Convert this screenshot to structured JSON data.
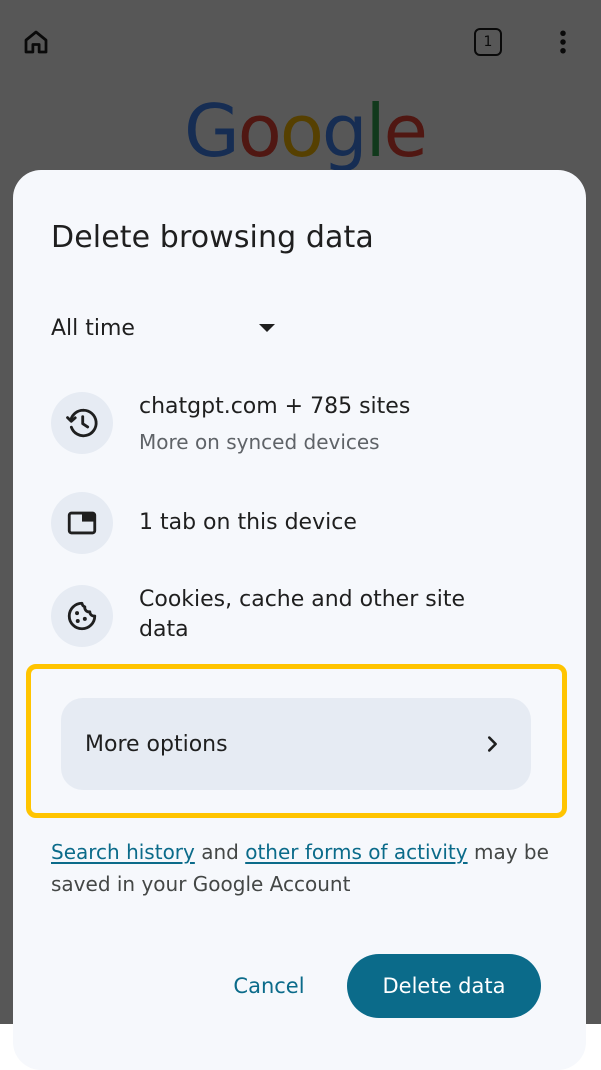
{
  "browser": {
    "tab_count": "1",
    "logo_text": "Google",
    "logo_colors": [
      "#4285F4",
      "#EA4335",
      "#FBBC05",
      "#4285F4",
      "#34A853",
      "#EA4335"
    ]
  },
  "dialog": {
    "title": "Delete browsing data",
    "time_range": {
      "selected": "All time"
    },
    "rows": [
      {
        "icon": "history-icon",
        "primary": "chatgpt.com + 785 sites",
        "secondary": "More on synced devices"
      },
      {
        "icon": "tab-icon",
        "primary": "1 tab on this device",
        "secondary": ""
      },
      {
        "icon": "cookie-icon",
        "primary": "Cookies, cache and other site data",
        "secondary": ""
      }
    ],
    "more_options_label": "More options",
    "footer": {
      "link_1": "Search history",
      "text_1": " and ",
      "link_2": "other forms of activity",
      "text_2": " may be saved in your Google Account"
    },
    "actions": {
      "cancel": "Cancel",
      "delete": "Delete data"
    }
  },
  "colors": {
    "accent": "#0b6b8a",
    "highlight": "#ffc400",
    "sheet_bg": "#f6f8fc",
    "icon_bg": "#e6ebf3"
  }
}
